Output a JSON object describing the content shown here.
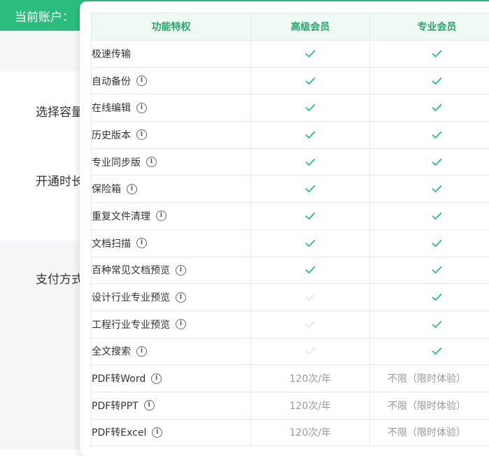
{
  "header": {
    "account_label": "当前账户："
  },
  "background_labels": {
    "capacity": "选择容量",
    "duration": "开通时长",
    "payment": "支付方式"
  },
  "table": {
    "headers": [
      "功能特权",
      "高级会员",
      "专业会员"
    ],
    "colors": {
      "check": "#2bbd7e",
      "check_faded": "#d8f1e4",
      "header_text": "#2aa36a"
    },
    "rows": [
      {
        "name": "极速传输",
        "info": false,
        "advanced": "check",
        "pro": "check"
      },
      {
        "name": "自动备份",
        "info": true,
        "advanced": "check",
        "pro": "check"
      },
      {
        "name": "在线编辑",
        "info": true,
        "advanced": "check",
        "pro": "check"
      },
      {
        "name": "历史版本",
        "info": true,
        "advanced": "check",
        "pro": "check"
      },
      {
        "name": "专业同步版",
        "info": true,
        "advanced": "check",
        "pro": "check"
      },
      {
        "name": "保险箱",
        "info": true,
        "advanced": "check",
        "pro": "check"
      },
      {
        "name": "重复文件清理",
        "info": true,
        "advanced": "check",
        "pro": "check"
      },
      {
        "name": "文档扫描",
        "info": true,
        "advanced": "check",
        "pro": "check"
      },
      {
        "name": "百种常见文档预览",
        "info": true,
        "advanced": "check",
        "pro": "check"
      },
      {
        "name": "设计行业专业预览",
        "info": true,
        "advanced": "check-disabled",
        "pro": "check"
      },
      {
        "name": "工程行业专业预览",
        "info": true,
        "advanced": "check-disabled",
        "pro": "check"
      },
      {
        "name": "全文搜索",
        "info": true,
        "advanced": "check-disabled",
        "pro": "check"
      },
      {
        "name": "PDF转Word",
        "info": true,
        "advanced": "120次/年",
        "pro": "不限（限时体验）"
      },
      {
        "name": "PDF转PPT",
        "info": true,
        "advanced": "120次/年",
        "pro": "不限（限时体验）"
      },
      {
        "name": "PDF转Excel",
        "info": true,
        "advanced": "120次/年",
        "pro": "不限（限时体验）"
      }
    ]
  }
}
